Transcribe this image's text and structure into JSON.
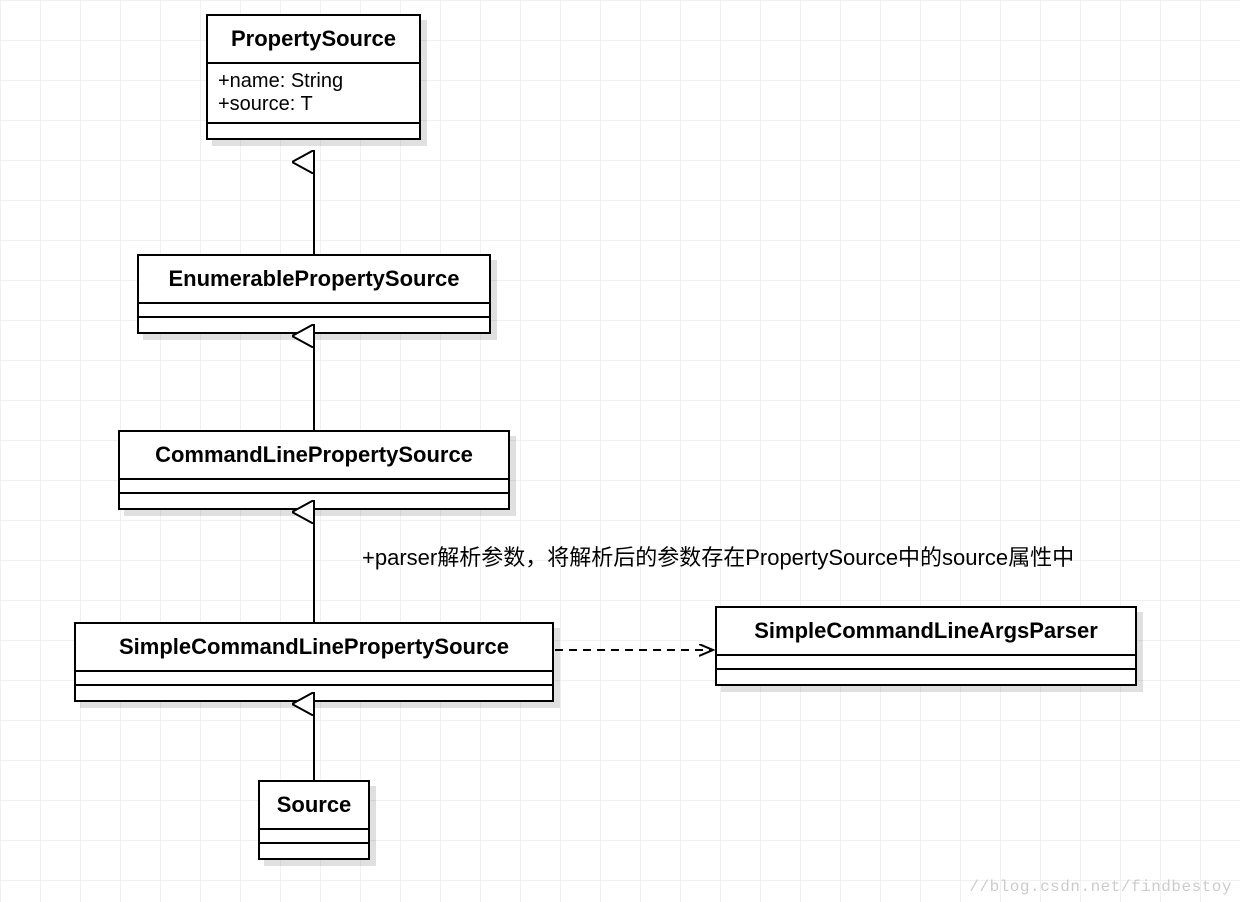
{
  "classes": {
    "propertySource": {
      "name": "PropertySource",
      "attrs": [
        "+name: String",
        "+source: T"
      ]
    },
    "enumerablePropertySource": {
      "name": "EnumerablePropertySource"
    },
    "commandLinePropertySource": {
      "name": "CommandLinePropertySource"
    },
    "simpleCommandLinePropertySource": {
      "name": "SimpleCommandLinePropertySource"
    },
    "simpleCommandLineArgsParser": {
      "name": "SimpleCommandLineArgsParser"
    },
    "source": {
      "name": "Source"
    }
  },
  "note": "+parser解析参数，将解析后的参数存在PropertySource中的source属性中",
  "watermark": "//blog.csdn.net/findbestoy"
}
